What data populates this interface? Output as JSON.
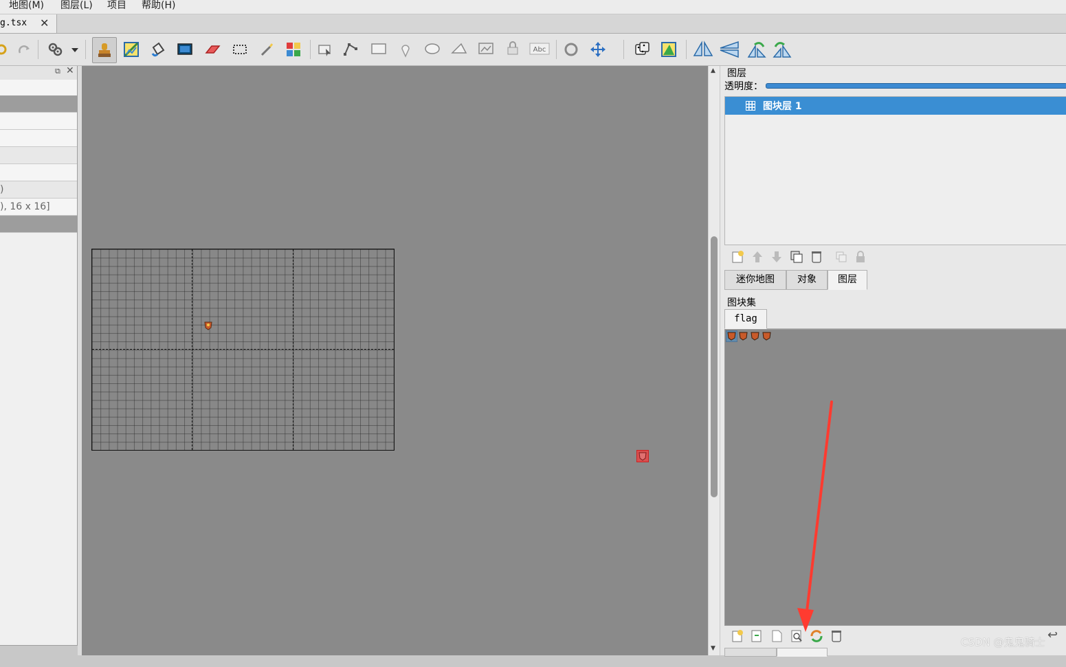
{
  "menu": {
    "items": [
      "地图(M)",
      "图层(L)",
      "项目",
      "帮助(H)"
    ]
  },
  "document": {
    "tab_label": "g.tsx",
    "close_glyph": "✕"
  },
  "toolbar": {
    "icons": [
      "redo-icon",
      "automapping-icon",
      "dropdown-icon",
      "stamp-brush-icon",
      "terrain-brush-icon",
      "bucket-fill-icon",
      "shape-fill-icon",
      "eraser-icon",
      "rect-select-icon",
      "magic-wand-icon",
      "select-same-tile-icon",
      "select-objects-icon",
      "edit-polygons-icon",
      "insert-rectangle-icon",
      "insert-point-icon",
      "insert-ellipse-icon",
      "insert-polygon-icon",
      "insert-tile-icon",
      "insert-template-icon",
      "insert-text-icon",
      "rotate-icon",
      "move-icon",
      "random-mode-icon",
      "wang-fill-icon",
      "flip-horizontal-icon",
      "flip-vertical-icon",
      "rotate-left-icon",
      "rotate-right-icon"
    ]
  },
  "properties_panel": {
    "rows": [
      "",
      "",
      "",
      "",
      "",
      "",
      ")",
      "), 16 x 16]",
      ""
    ]
  },
  "layers_panel": {
    "title": "图层",
    "opacity_label": "透明度：",
    "layers": [
      {
        "name": "图块层 1",
        "selected": true
      }
    ],
    "tabs": [
      "迷你地图",
      "对象",
      "图层"
    ],
    "selected_tab": "图层"
  },
  "tilesets_panel": {
    "title": "图块集",
    "tabs": [
      "flag"
    ],
    "tile_count": 4
  },
  "watermark": "CSDN @鬼鬼骑士",
  "colors": {
    "accent": "#3a8ed3",
    "arrow": "#ff3b30",
    "canvas": "#8a8a8a"
  }
}
